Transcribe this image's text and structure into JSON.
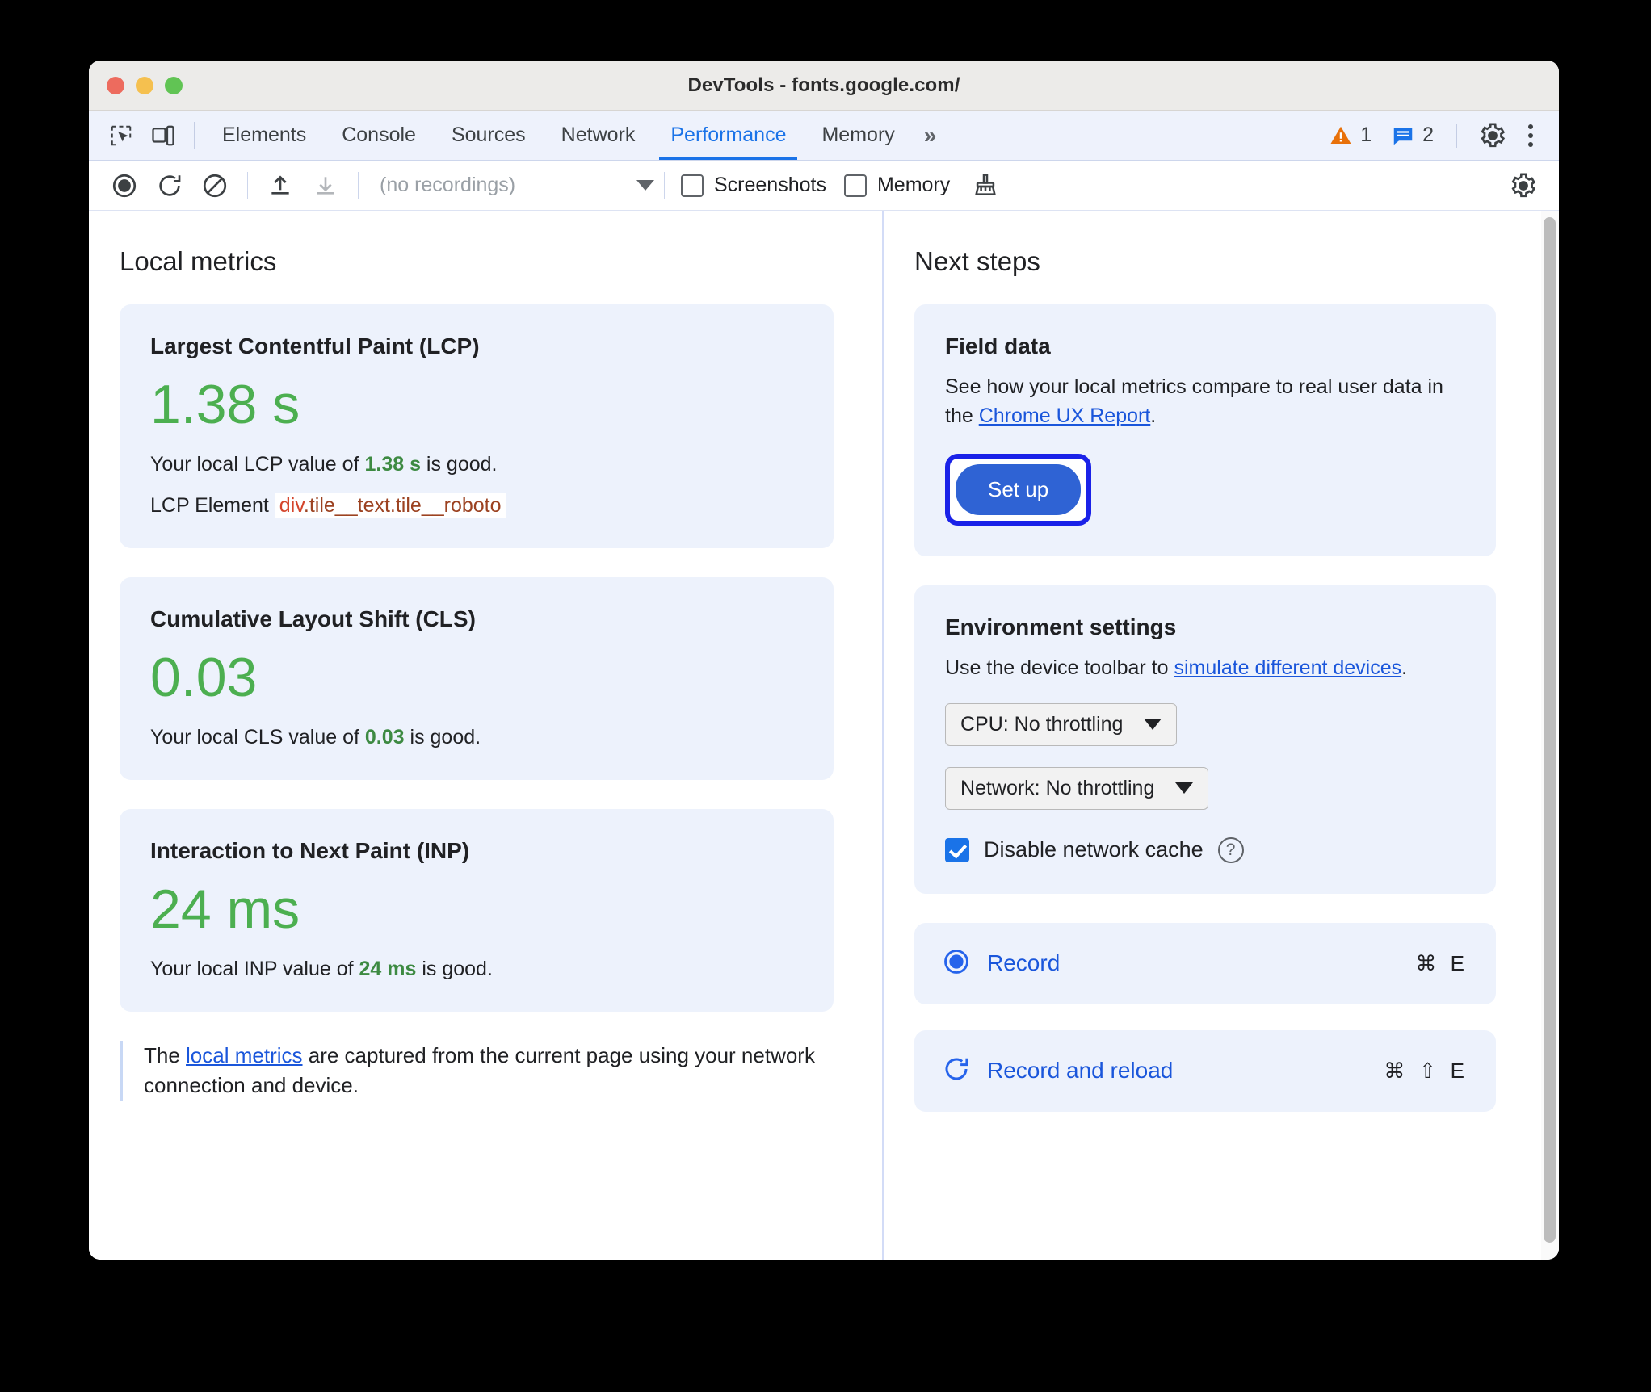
{
  "window": {
    "title": "DevTools - fonts.google.com/",
    "traffic_lights": [
      "close-red",
      "minimize-yellow",
      "zoom-green"
    ]
  },
  "tabbar": {
    "icons": [
      "inspect-element-icon",
      "device-toolbar-icon"
    ],
    "tabs": [
      {
        "label": "Elements",
        "active": false
      },
      {
        "label": "Console",
        "active": false
      },
      {
        "label": "Sources",
        "active": false
      },
      {
        "label": "Network",
        "active": false
      },
      {
        "label": "Performance",
        "active": true
      },
      {
        "label": "Memory",
        "active": false
      }
    ],
    "more_tabs": "»",
    "warning_count": "1",
    "message_count": "2",
    "settings_icon": "gear-icon",
    "more_options_icon": "kebab-menu-icon"
  },
  "perfbar": {
    "record_icon": "record-circle-icon",
    "record_reload_icon": "reload-record-icon",
    "clear_icon": "clear-prohibited-icon",
    "upload_icon": "upload-icon",
    "download_icon": "download-icon",
    "recordings_value": "(no recordings)",
    "screenshots_label": "Screenshots",
    "screenshots_checked": false,
    "memory_label": "Memory",
    "memory_checked": false,
    "brush_icon": "brush-icon",
    "settings_icon": "gear-icon"
  },
  "local_metrics": {
    "title": "Local metrics",
    "lcp": {
      "name": "Largest Contentful Paint (LCP)",
      "value": "1.38 s",
      "desc_prefix": "Your local LCP value of ",
      "desc_value": "1.38 s",
      "desc_suffix": " is good.",
      "element_label": "LCP Element",
      "element_tag": "div",
      "element_class": ".tile__text.tile__roboto"
    },
    "cls": {
      "name": "Cumulative Layout Shift (CLS)",
      "value": "0.03",
      "desc_prefix": "Your local CLS value of ",
      "desc_value": "0.03",
      "desc_suffix": " is good."
    },
    "inp": {
      "name": "Interaction to Next Paint (INP)",
      "value": "24 ms",
      "desc_prefix": "Your local INP value of ",
      "desc_value": "24 ms",
      "desc_suffix": " is good."
    },
    "note_prefix": "The ",
    "note_link": "local metrics",
    "note_suffix": " are captured from the current page using your network connection and device."
  },
  "next_steps": {
    "title": "Next steps",
    "field_data": {
      "title": "Field data",
      "body_prefix": "See how your local metrics compare to real user data in the ",
      "body_link": "Chrome UX Report",
      "body_suffix": ".",
      "button_label": "Set up"
    },
    "environment": {
      "title": "Environment settings",
      "body_prefix": "Use the device toolbar to ",
      "body_link": "simulate different devices",
      "body_suffix": ".",
      "cpu_select": "CPU: No throttling",
      "network_select": "Network: No throttling",
      "disable_cache_label": "Disable network cache",
      "disable_cache_checked": true,
      "help_glyph": "?"
    },
    "actions": [
      {
        "label": "Record",
        "shortcut": "⌘ E",
        "icon": "record-circle-icon"
      },
      {
        "label": "Record and reload",
        "shortcut": "⌘ ⇧ E",
        "icon": "reload-record-icon"
      }
    ]
  },
  "colors": {
    "accent_blue": "#1a73e8",
    "link_blue": "#1a56db",
    "good_green": "#4caf50",
    "card_bg": "#edf2fc",
    "focus_ring": "#1a22e8",
    "primary_button": "#2f63d4"
  }
}
